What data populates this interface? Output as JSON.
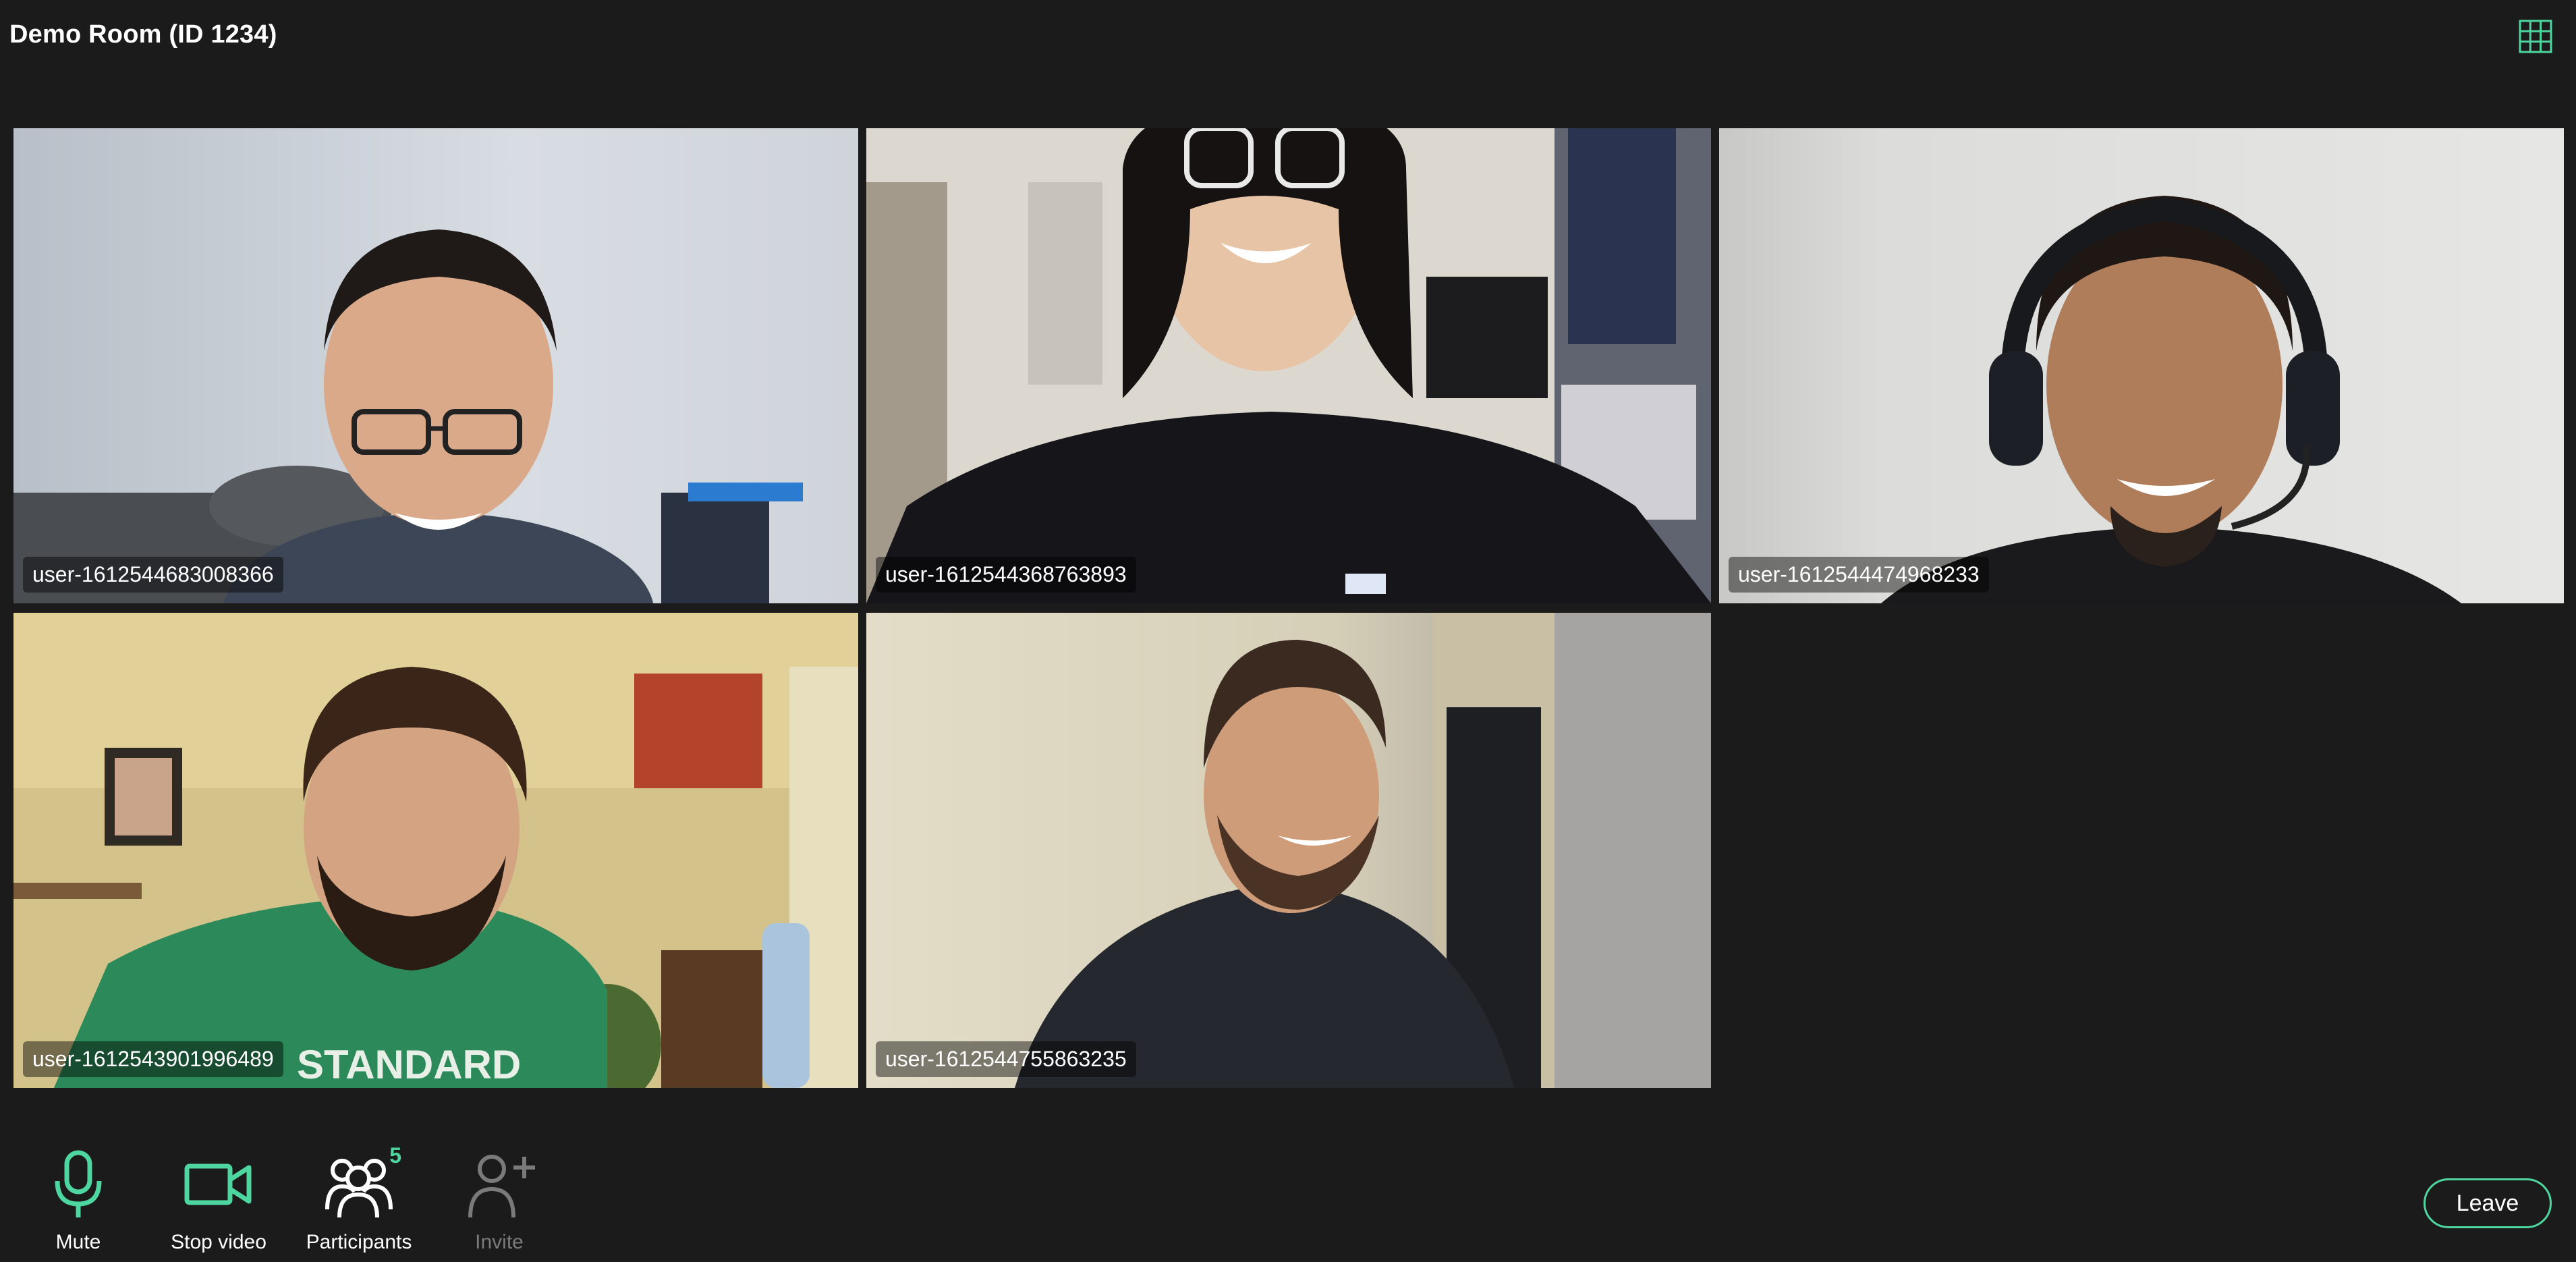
{
  "room": {
    "title": "Demo Room (ID 1234)"
  },
  "header": {
    "layout_icon": "grid-layout-icon"
  },
  "participants": [
    {
      "name": "user-1612544683008366"
    },
    {
      "name": "user-1612544368763893"
    },
    {
      "name": "user-1612544474968233"
    },
    {
      "name": "user-1612543901996489"
    },
    {
      "name": "user-1612544755863235"
    }
  ],
  "controls": {
    "mute": {
      "label": "Mute",
      "icon": "microphone-icon"
    },
    "video": {
      "label": "Stop video",
      "icon": "video-camera-icon"
    },
    "participants": {
      "label": "Participants",
      "icon": "participants-icon",
      "count": "5"
    },
    "invite": {
      "label": "Invite",
      "icon": "add-person-icon",
      "disabled": true
    },
    "leave": {
      "label": "Leave"
    }
  },
  "colors": {
    "accent": "#4ed6a0",
    "background": "#1b1b1b",
    "disabled": "#7a7a7a"
  }
}
